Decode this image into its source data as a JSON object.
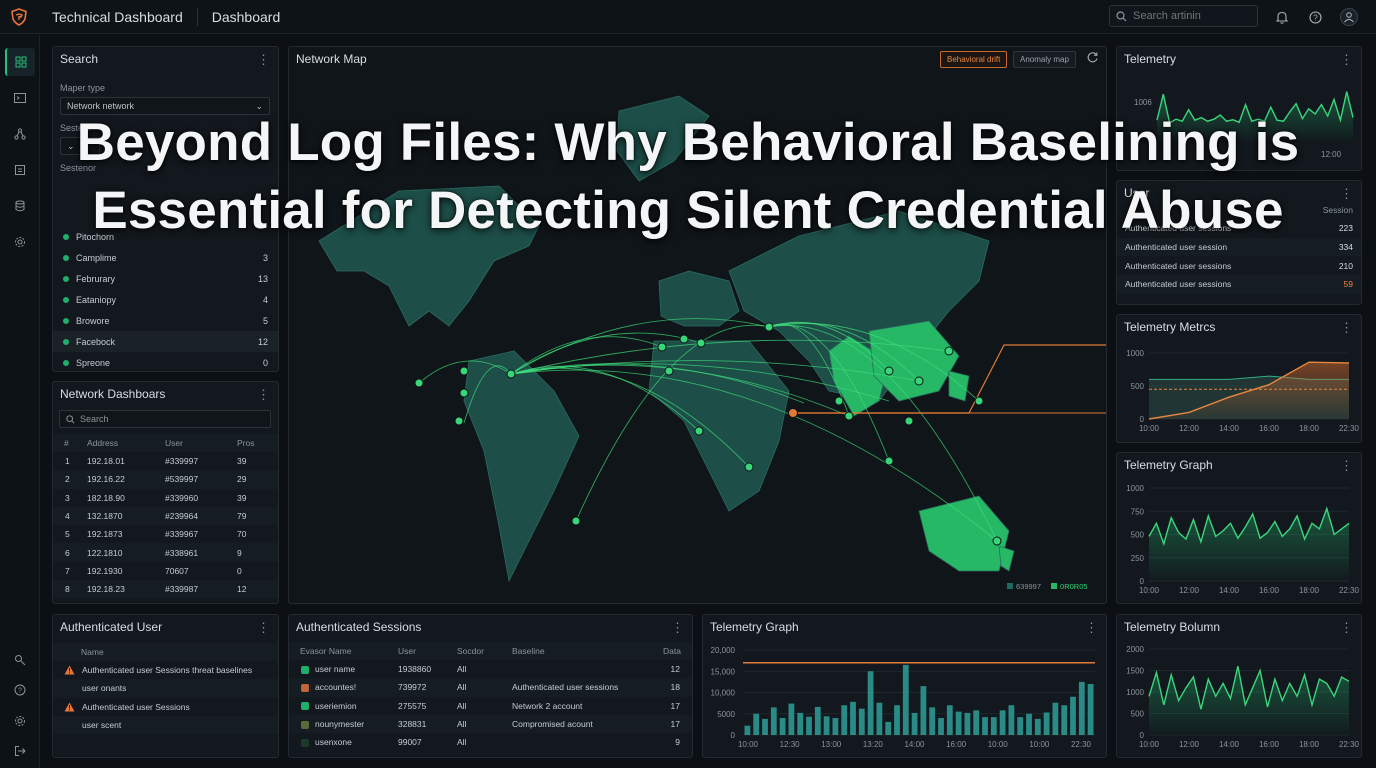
{
  "topbar": {
    "app_title": "Technical Dashboard",
    "breadcrumb": "Dashboard",
    "search_placeholder": "Search artinin"
  },
  "headline": {
    "line1": "Beyond Log Files: Why Behavioral Baselining is",
    "line2": "Essential for Detecting Silent Credential Abuse"
  },
  "search_panel": {
    "title": "Search",
    "map_type_label": "Maper type",
    "map_type_value": "Network network",
    "systems_label": "Sestem",
    "sessions_label": "Sestenor",
    "items": [
      {
        "label": "Pitochorn",
        "count": ""
      },
      {
        "label": "Camplime",
        "count": "3"
      },
      {
        "label": "Februrary",
        "count": "13"
      },
      {
        "label": "Eataniopy",
        "count": "4"
      },
      {
        "label": "Browore",
        "count": "5"
      },
      {
        "label": "Facebock",
        "count": "12"
      },
      {
        "label": "Spreone",
        "count": "0"
      }
    ]
  },
  "network_dashboards": {
    "title": "Network Dashboars",
    "search_placeholder": "Search",
    "columns": [
      "#",
      "Address",
      "User",
      "Pros"
    ],
    "rows": [
      [
        "1",
        "192.18.01",
        "#339997",
        "39"
      ],
      [
        "2",
        "192.16.22",
        "#539997",
        "29"
      ],
      [
        "3",
        "182.18.90",
        "#339960",
        "39"
      ],
      [
        "4",
        "132.1870",
        "#239964",
        "79"
      ],
      [
        "5",
        "192.1873",
        "#339967",
        "70"
      ],
      [
        "6",
        "122.1810",
        "#338961",
        "9"
      ],
      [
        "7",
        "192.1930",
        "70607",
        "0"
      ],
      [
        "8",
        "192.18.23",
        "#339987",
        "12"
      ]
    ]
  },
  "network_map": {
    "title": "Network Map",
    "btn_behavioral": "Behavioral drift",
    "btn_anomaly": "Anomaly map",
    "legend": [
      "639997",
      "0R0R05"
    ],
    "colors": {
      "land": "#1d4e48",
      "active": "#26b865",
      "link": "#3fe07c",
      "alert": "#e07a35"
    }
  },
  "telemetry_top": {
    "title": "Telemetry",
    "y_label": "1006",
    "x_label": "12:00"
  },
  "user_sessions": {
    "title": "User",
    "session_header": "Session",
    "rows": [
      {
        "label": "Authenticated user sessions",
        "value": "223"
      },
      {
        "label": "Authenticated user session",
        "value": "334"
      },
      {
        "label": "Authenticated user sessions",
        "value": "210"
      },
      {
        "label": "Authenticated user sessions",
        "value": "59"
      }
    ]
  },
  "telemetry_metrics": {
    "title": "Telemetry Metrcs",
    "y_ticks": [
      "1000",
      "500",
      "0"
    ],
    "x_ticks": [
      "10:00",
      "12:00",
      "14:00",
      "16:00",
      "18:00",
      "22:30"
    ]
  },
  "telemetry_graph_right": {
    "title": "Telemetry Graph",
    "y_ticks": [
      "1000",
      "750",
      "500",
      "250",
      "0"
    ],
    "x_ticks": [
      "10:00",
      "12:00",
      "14:00",
      "16:00",
      "18:00",
      "22:30"
    ]
  },
  "authenticated_user": {
    "title": "Authenticated User",
    "column": "Name",
    "rows": [
      {
        "text": "Authenticated user Sessions threat baselines",
        "warn": true
      },
      {
        "text": "user onants",
        "warn": false
      },
      {
        "text": "Authenticated user Sessions",
        "warn": true
      },
      {
        "text": "user scent",
        "warn": false
      }
    ]
  },
  "authenticated_sessions": {
    "title": "Authenticated Sessions",
    "columns": [
      "Evasor Name",
      "User",
      "Socdor",
      "Baseline",
      "Data"
    ],
    "rows": [
      {
        "name": "user name",
        "user": "1938860",
        "sess": "All",
        "baseline": "",
        "data": "12",
        "icon": "#1fae6b"
      },
      {
        "name": "accountes!",
        "user": "739972",
        "sess": "All",
        "baseline": "Authenticated user sessions",
        "data": "18",
        "icon": "#c0643a"
      },
      {
        "name": "useriemion",
        "user": "275575",
        "sess": "All",
        "baseline": "Network 2 account",
        "data": "17",
        "icon": "#1fae6b"
      },
      {
        "name": "nounymester",
        "user": "328831",
        "sess": "All",
        "baseline": "Compromised acount",
        "data": "17",
        "icon": "#5a6b3a"
      },
      {
        "name": "usenxone",
        "user": "99007",
        "sess": "All",
        "baseline": "",
        "data": "9",
        "icon": "#1c3a2c"
      }
    ]
  },
  "telemetry_graph_bottom": {
    "title": "Telemetry Graph",
    "y_ticks": [
      "20,000",
      "15,000",
      "10,000",
      "5000",
      "0"
    ],
    "x_ticks": [
      "10:00",
      "12:30",
      "13:00",
      "13:20",
      "14:00",
      "16:00",
      "10:00",
      "10:00",
      "22:30"
    ]
  },
  "telemetry_bolumn": {
    "title": "Telemetry Bolumn",
    "y_ticks": [
      "2000",
      "1500",
      "1000",
      "500",
      "0"
    ],
    "x_ticks": [
      "10:00",
      "12:00",
      "14:00",
      "16:00",
      "18:00",
      "22:30"
    ]
  },
  "chart_data": [
    {
      "type": "line",
      "title": "Telemetry",
      "series": [
        {
          "values": [
            400,
            900,
            350,
            420,
            380,
            600,
            400,
            450,
            380,
            420,
            500,
            380,
            410,
            360,
            700,
            380,
            420,
            380,
            650,
            400,
            380,
            560,
            720,
            430,
            620,
            520,
            700,
            480,
            800,
            400,
            950,
            450
          ]
        }
      ]
    },
    {
      "type": "area",
      "title": "Telemetry Metrcs",
      "x": [
        "10:00",
        "12:00",
        "14:00",
        "16:00",
        "18:00",
        "22:30"
      ],
      "ylim": [
        0,
        1000
      ],
      "series": [
        {
          "values": [
            0,
            100,
            330,
            520,
            860,
            850
          ]
        },
        {
          "values": [
            600,
            600,
            600,
            650,
            600,
            600
          ]
        }
      ],
      "threshold": 450
    },
    {
      "type": "line",
      "title": "Telemetry Graph",
      "ylim": [
        0,
        1000
      ],
      "series": [
        {
          "values": [
            480,
            620,
            400,
            680,
            520,
            450,
            660,
            420,
            700,
            480,
            540,
            620,
            460,
            580,
            720,
            460,
            520,
            640,
            480,
            560,
            700,
            450,
            620,
            560,
            780,
            500,
            560,
            620
          ]
        }
      ]
    },
    {
      "type": "bar",
      "title": "Telemetry Graph",
      "ylim": [
        0,
        20000
      ],
      "values": [
        2200,
        5000,
        3800,
        6500,
        4000,
        7400,
        5200,
        4300,
        6600,
        4400,
        4000,
        7000,
        7800,
        6200,
        15000,
        7600,
        3100,
        7000,
        16500,
        5200,
        11500,
        6500,
        4000,
        7000,
        5500,
        5200,
        5800,
        4200,
        4200,
        5800,
        7000,
        4200,
        5000,
        3800,
        5300,
        7600,
        7000,
        9000,
        12500,
        12000
      ],
      "threshold": 17000
    },
    {
      "type": "line",
      "title": "Telemetry Bolumn",
      "ylim": [
        0,
        2000
      ],
      "series": [
        {
          "values": [
            900,
            1450,
            700,
            1400,
            800,
            1100,
            1350,
            600,
            1300,
            900,
            1200,
            850,
            1600,
            700,
            1100,
            1500,
            650,
            1300,
            800,
            1200,
            900,
            1400,
            700,
            1300,
            1200,
            900,
            1350,
            1250
          ]
        }
      ]
    }
  ]
}
